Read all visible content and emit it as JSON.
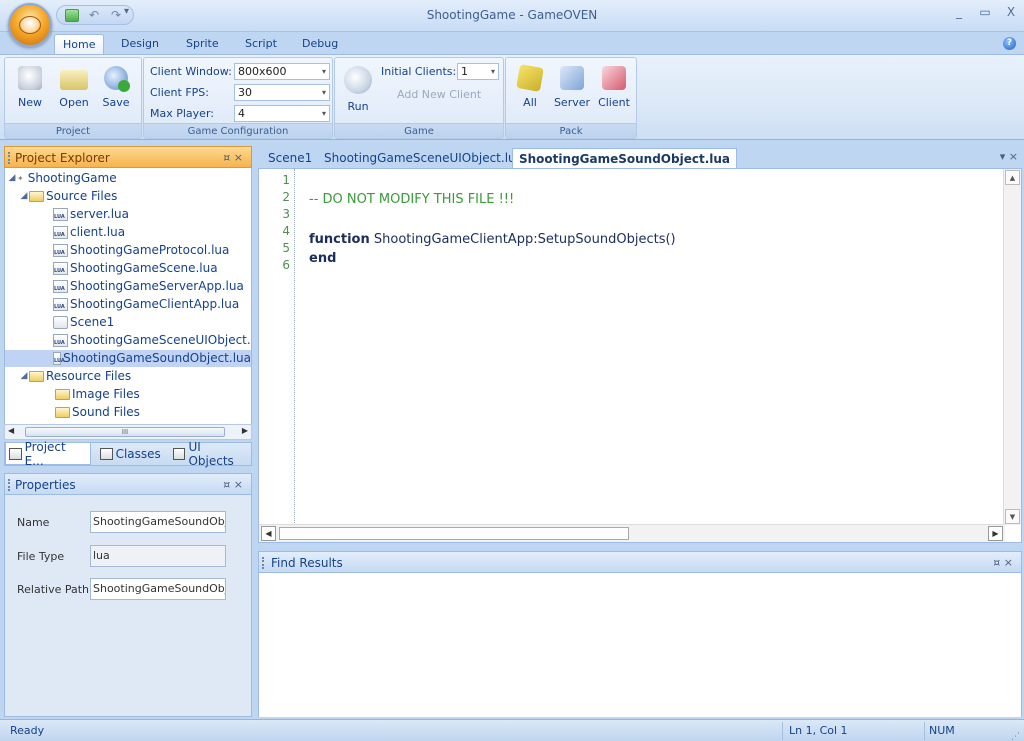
{
  "window": {
    "title": "ShootingGame - GameOVEN",
    "controls": [
      "_",
      "▭",
      "X"
    ]
  },
  "ribbon": {
    "tabs": [
      "Home",
      "Design",
      "Sprite",
      "Script",
      "Debug"
    ],
    "active_tab": "Home",
    "project_group": {
      "label": "Project",
      "new": "New",
      "open": "Open",
      "save": "Save"
    },
    "config_group": {
      "label": "Game Configuration",
      "client_window_label": "Client Window:",
      "client_window_value": "800x600",
      "client_fps_label": "Client FPS:",
      "client_fps_value": "30",
      "max_player_label": "Max Player:",
      "max_player_value": "4"
    },
    "game_group": {
      "label": "Game",
      "run": "Run",
      "initial_clients_label": "Initial Clients:",
      "initial_clients_value": "1",
      "add_new_client": "Add New Client"
    },
    "pack_group": {
      "label": "Pack",
      "all": "All",
      "server": "Server",
      "client": "Client"
    }
  },
  "explorer": {
    "title": "Project Explorer",
    "pin": "¤ ×",
    "root": "ShootingGame",
    "source_folder": "Source Files",
    "source_files": [
      "server.lua",
      "client.lua",
      "ShootingGameProtocol.lua",
      "ShootingGameScene.lua",
      "ShootingGameServerApp.lua",
      "ShootingGameClientApp.lua",
      "Scene1",
      "ShootingGameSceneUIObject.lua",
      "ShootingGameSoundObject.lua"
    ],
    "selected_file": "ShootingGameSoundObject.lua",
    "resource_folder": "Resource Files",
    "resource_subfolders": [
      "Image Files",
      "Sound Files"
    ],
    "scroll_thumb": "III",
    "bottom_tabs": [
      "Project E...",
      "Classes",
      "UI Objects"
    ]
  },
  "properties": {
    "title": "Properties",
    "name_label": "Name",
    "name_value": "ShootingGameSoundObject.",
    "filetype_label": "File Type",
    "filetype_value": "lua",
    "relpath_label": "Relative Path",
    "relpath_value": "ShootingGameSoundObject."
  },
  "editor": {
    "tabs": [
      "Scene1",
      "ShootingGameSceneUIObject.lua",
      "ShootingGameSoundObject.lua"
    ],
    "active_tab": "ShootingGameSoundObject.lua",
    "tab_controls": "▾ ×",
    "line_numbers": [
      "1",
      "2",
      "3",
      "4",
      "5",
      "6"
    ],
    "lines": [
      {
        "type": "blank",
        "text": ""
      },
      {
        "type": "comment",
        "text": "-- DO NOT MODIFY THIS FILE !!!"
      },
      {
        "type": "blank",
        "text": ""
      },
      {
        "type": "function",
        "keyword": "function",
        "text": "ShootingGameClientApp:SetupSoundObjects()"
      },
      {
        "type": "keyword",
        "keyword": "end",
        "text": ""
      },
      {
        "type": "blank",
        "text": ""
      }
    ]
  },
  "find_results": {
    "title": "Find Results",
    "pin": "¤ ×"
  },
  "status": {
    "text": "Ready",
    "position": "Ln 1, Col 1",
    "num": "NUM"
  }
}
